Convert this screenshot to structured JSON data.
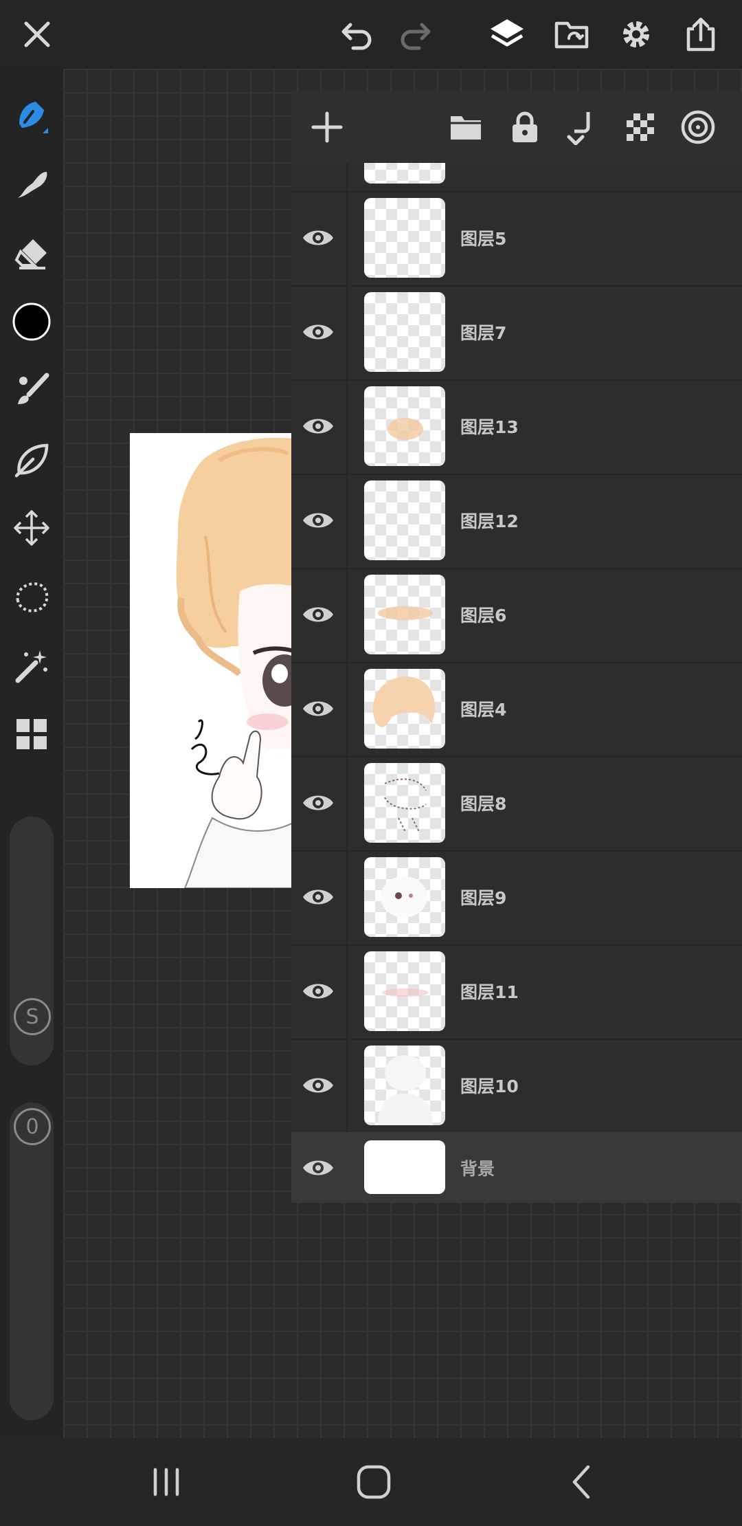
{
  "topbar": {
    "icons": [
      "close-icon",
      "undo-icon",
      "redo-icon",
      "layers-icon",
      "import-icon",
      "settings-icon",
      "share-icon"
    ]
  },
  "left_toolbar": {
    "tools": [
      "brush-tool",
      "smudge-tool",
      "eraser-tool",
      "color-swatch",
      "paint-tool",
      "liquify-tool",
      "transform-tool",
      "lasso-tool",
      "magic-wand-tool",
      "grid-tool"
    ],
    "size_label": "S",
    "opacity_label": "0",
    "current_color": "#000000",
    "accent_color": "#2b8ce6"
  },
  "layers_panel": {
    "toolbar_icons": [
      "add-layer-icon",
      "folder-icon",
      "lock-icon",
      "merge-down-icon",
      "transparency-icon",
      "target-icon"
    ],
    "layers": [
      {
        "name": "图层5",
        "visible": true
      },
      {
        "name": "图层7",
        "visible": true
      },
      {
        "name": "图层13",
        "visible": true
      },
      {
        "name": "图层12",
        "visible": true
      },
      {
        "name": "图层6",
        "visible": true
      },
      {
        "name": "图层4",
        "visible": true
      },
      {
        "name": "图层8",
        "visible": true
      },
      {
        "name": "图层9",
        "visible": true
      },
      {
        "name": "图层11",
        "visible": true
      },
      {
        "name": "图层10",
        "visible": true
      }
    ],
    "background": {
      "name": "背景",
      "visible": true
    }
  },
  "navbar": {
    "buttons": [
      "recents-button",
      "home-button",
      "back-button"
    ]
  }
}
